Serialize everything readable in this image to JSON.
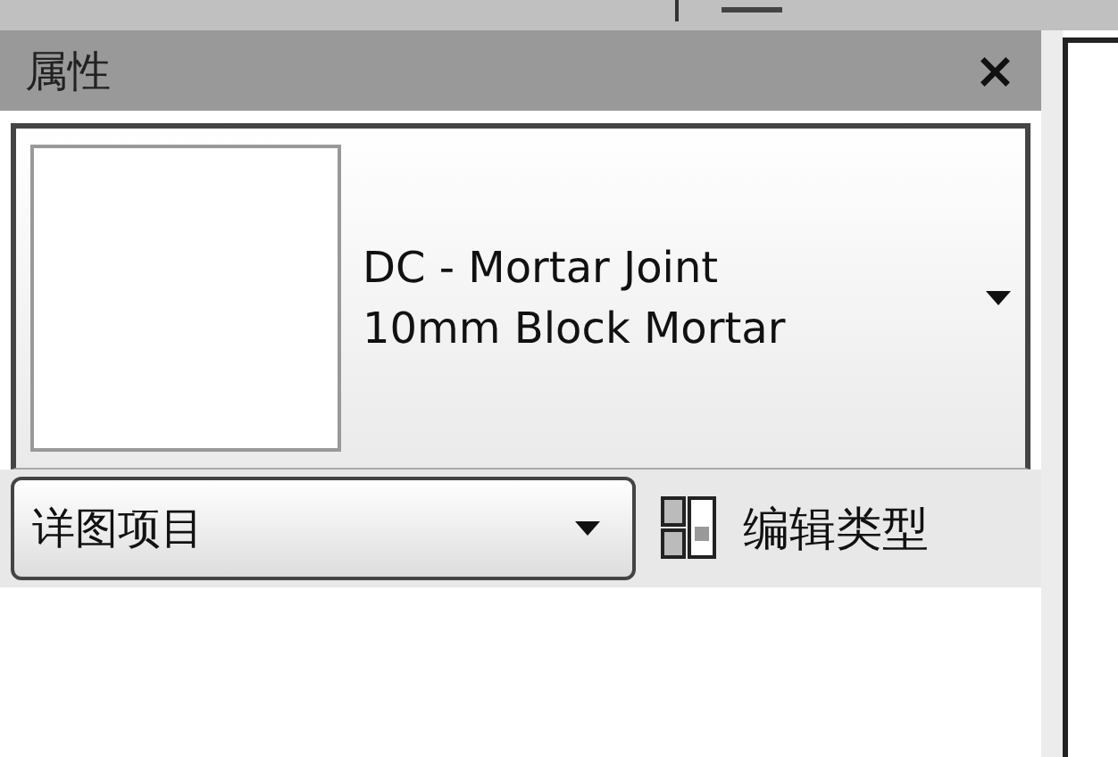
{
  "panel": {
    "title": "属性",
    "close": "×"
  },
  "type_selector": {
    "family": "DC - Mortar Joint",
    "type": "10mm Block Mortar"
  },
  "filter": {
    "value": "详图项目"
  },
  "edit_type_button": {
    "label": "编辑类型"
  }
}
